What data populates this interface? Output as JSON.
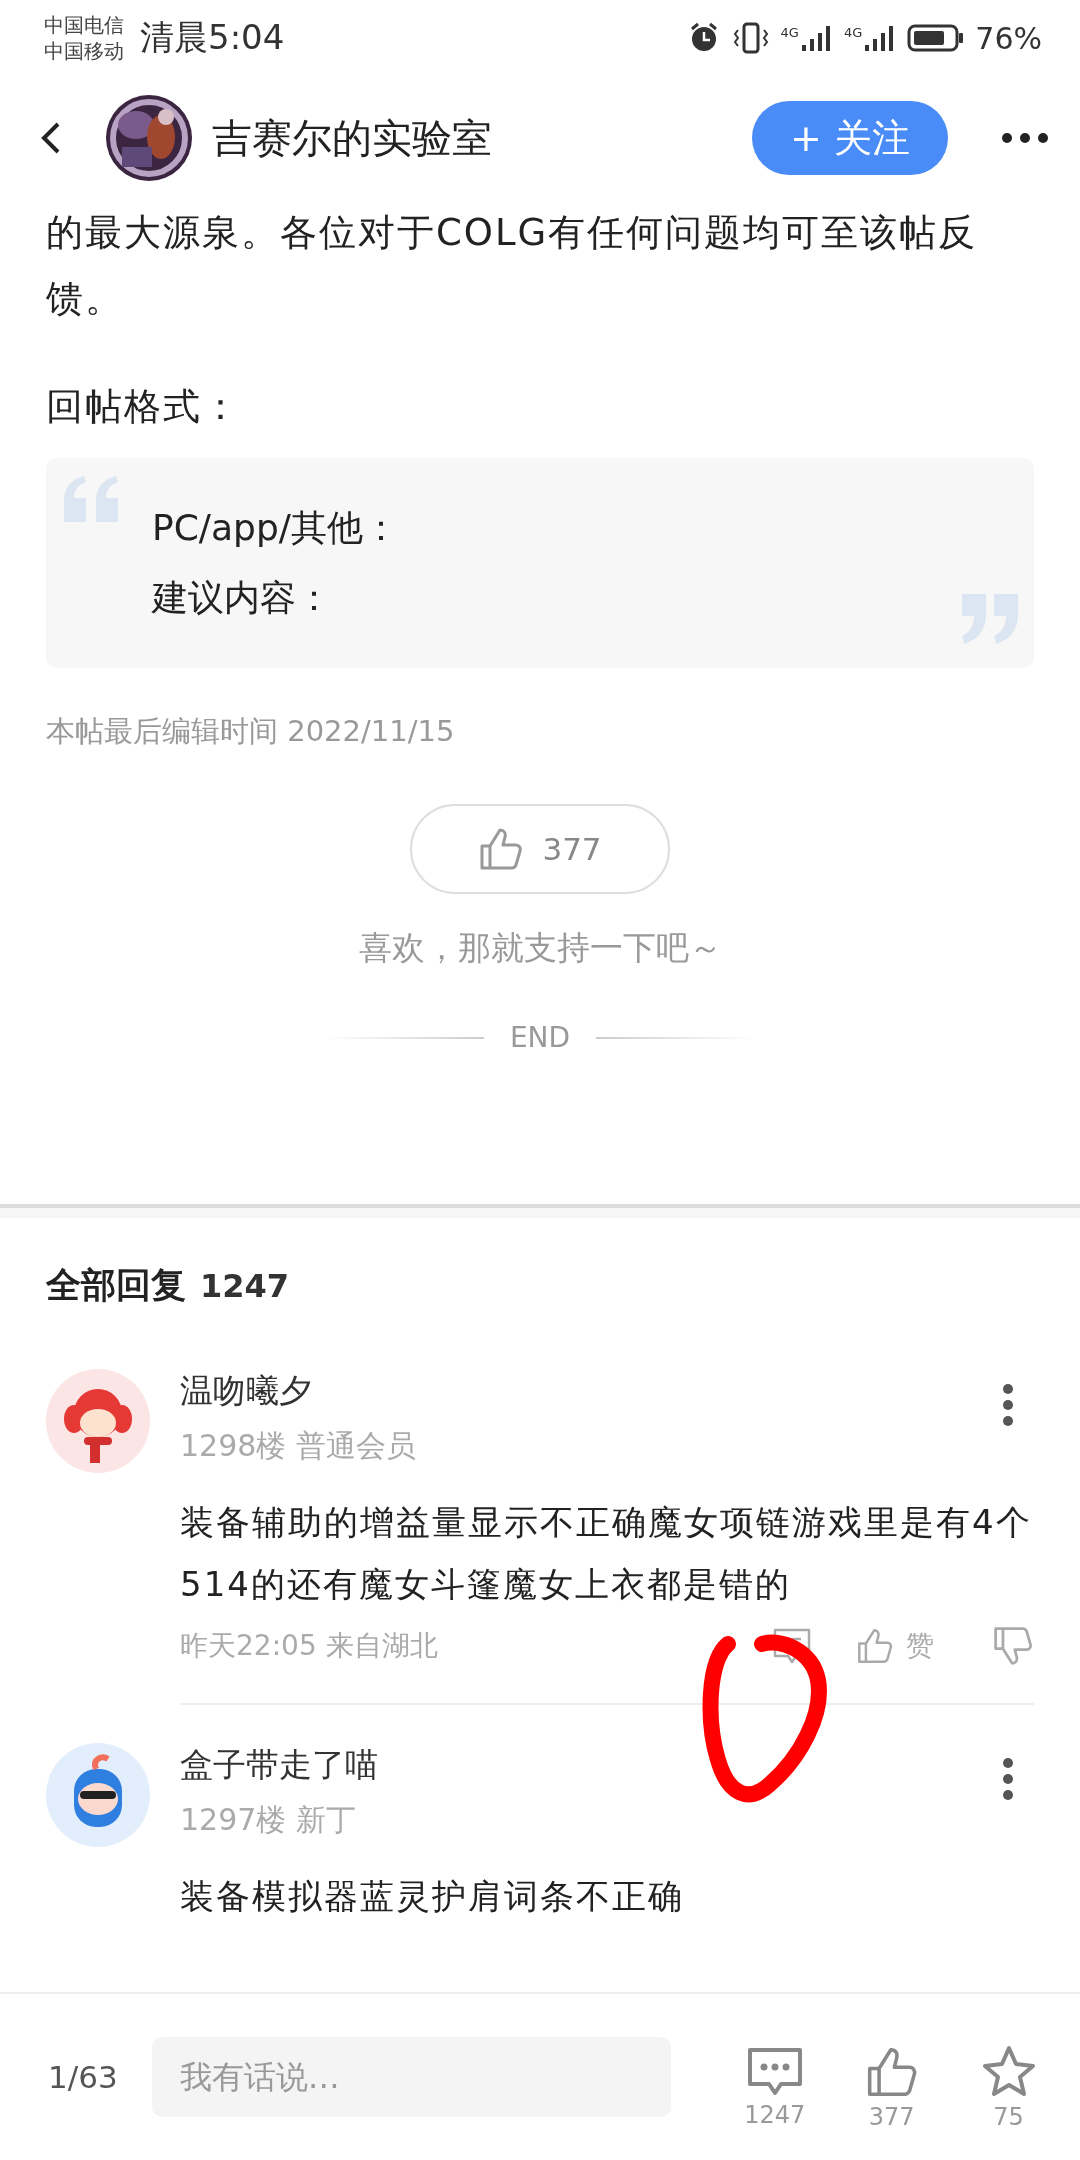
{
  "status_bar": {
    "carriers": [
      "中国电信",
      "中国移动"
    ],
    "time": "清晨5:04",
    "network_labels": [
      "4G",
      "4G"
    ],
    "battery": "76%"
  },
  "header": {
    "title": "吉赛尔的实验室",
    "follow_button": "+ 关注"
  },
  "post": {
    "paragraph": "的最大源泉。各位对于COLG有任何问题均可至该帖反馈。",
    "format_label": "回帖格式：",
    "quote_lines": [
      "PC/app/其他：",
      "建议内容："
    ],
    "edit_time": "本帖最后编辑时间 2022/11/15",
    "like_count": "377",
    "like_prompt": "喜欢，那就支持一下吧～",
    "end_label": "END"
  },
  "replies": {
    "title": "全部回复",
    "count": "1247",
    "items": [
      {
        "kind": "girl",
        "name": "温吻曦夕",
        "floor": "1298楼",
        "rank": "普通会员",
        "text": "装备辅助的增益量显示不正确魔女项链游戏里是有4个514的还有魔女斗篷魔女上衣都是错的",
        "time": "昨天22:05 来自湖北",
        "like_label": "赞"
      },
      {
        "kind": "boy",
        "name": "盒子带走了喵",
        "floor": "1297楼",
        "rank": "新丁",
        "text": "装备模拟器蓝灵护肩词条不正确"
      }
    ]
  },
  "bottom_bar": {
    "page": "1/63",
    "input": {
      "placeholder": "我有话说…"
    },
    "actions": [
      {
        "kind": "comment",
        "count": "1247"
      },
      {
        "kind": "like",
        "count": "377"
      },
      {
        "kind": "star",
        "count": "75"
      }
    ]
  }
}
